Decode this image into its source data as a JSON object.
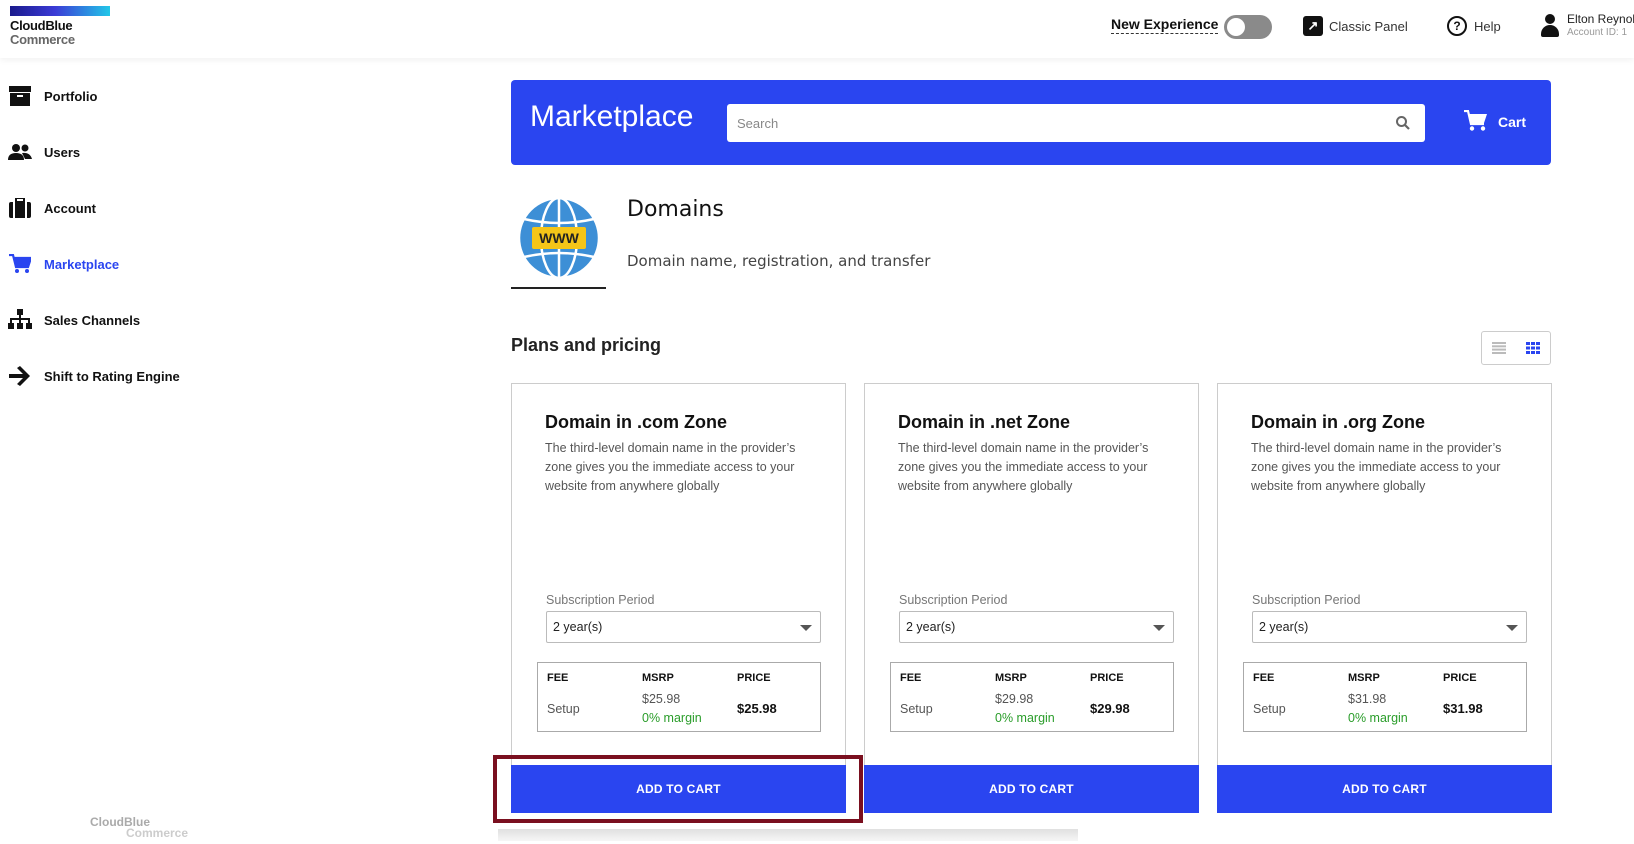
{
  "app": {
    "logo_line1": "CloudBlue",
    "logo_line2": "Commerce"
  },
  "topbar": {
    "new_experience": "New Experience",
    "new_experience_on": false,
    "classic_panel": "Classic Panel",
    "help": "Help",
    "user_name": "Elton Reynolds",
    "account_id": "Account ID: 1"
  },
  "sidebar": {
    "items": [
      {
        "label": "Portfolio",
        "icon": "archive-box-icon"
      },
      {
        "label": "Users",
        "icon": "users-icon"
      },
      {
        "label": "Account",
        "icon": "briefcase-icon"
      },
      {
        "label": "Marketplace",
        "icon": "cart-icon",
        "active": true
      },
      {
        "label": "Sales Channels",
        "icon": "hierarchy-icon"
      },
      {
        "label": "Shift to Rating Engine",
        "icon": "arrow-right-icon"
      }
    ],
    "footer_line1": "CloudBlue",
    "footer_line2": "Commerce"
  },
  "banner": {
    "title": "Marketplace",
    "search_placeholder": "Search",
    "cart_label": "Cart"
  },
  "product": {
    "name": "Domains",
    "description": "Domain name, registration, and transfer",
    "logo_text": "WWW"
  },
  "plans_section": {
    "title": "Plans and pricing",
    "view_mode": "grid"
  },
  "plans": [
    {
      "title": "Domain in .com Zone",
      "description": "The third-level domain name in the provider’s zone gives you the immediate access to your website from anywhere globally",
      "subscription_label": "Subscription Period",
      "subscription_value": "2 year(s)",
      "headers": {
        "fee": "FEE",
        "msrp": "MSRP",
        "price": "PRICE"
      },
      "fee": "Setup",
      "msrp": "$25.98",
      "margin": "0% margin",
      "price": "$25.98",
      "button": "ADD TO CART"
    },
    {
      "title": "Domain in .net Zone",
      "description": "The third-level domain name in the provider’s zone gives you the immediate access to your website from anywhere globally",
      "subscription_label": "Subscription Period",
      "subscription_value": "2 year(s)",
      "headers": {
        "fee": "FEE",
        "msrp": "MSRP",
        "price": "PRICE"
      },
      "fee": "Setup",
      "msrp": "$29.98",
      "margin": "0% margin",
      "price": "$29.98",
      "button": "ADD TO CART"
    },
    {
      "title": "Domain in .org Zone",
      "description": "The third-level domain name in the provider’s zone gives you the immediate access to your website from anywhere globally",
      "subscription_label": "Subscription Period",
      "subscription_value": "2 year(s)",
      "headers": {
        "fee": "FEE",
        "msrp": "MSRP",
        "price": "PRICE"
      },
      "fee": "Setup",
      "msrp": "$31.98",
      "margin": "0% margin",
      "price": "$31.98",
      "button": "ADD TO CART"
    }
  ],
  "colors": {
    "accent": "#2a45f0",
    "margin_green": "#2a9d2a",
    "highlight": "#7a0f1f"
  }
}
